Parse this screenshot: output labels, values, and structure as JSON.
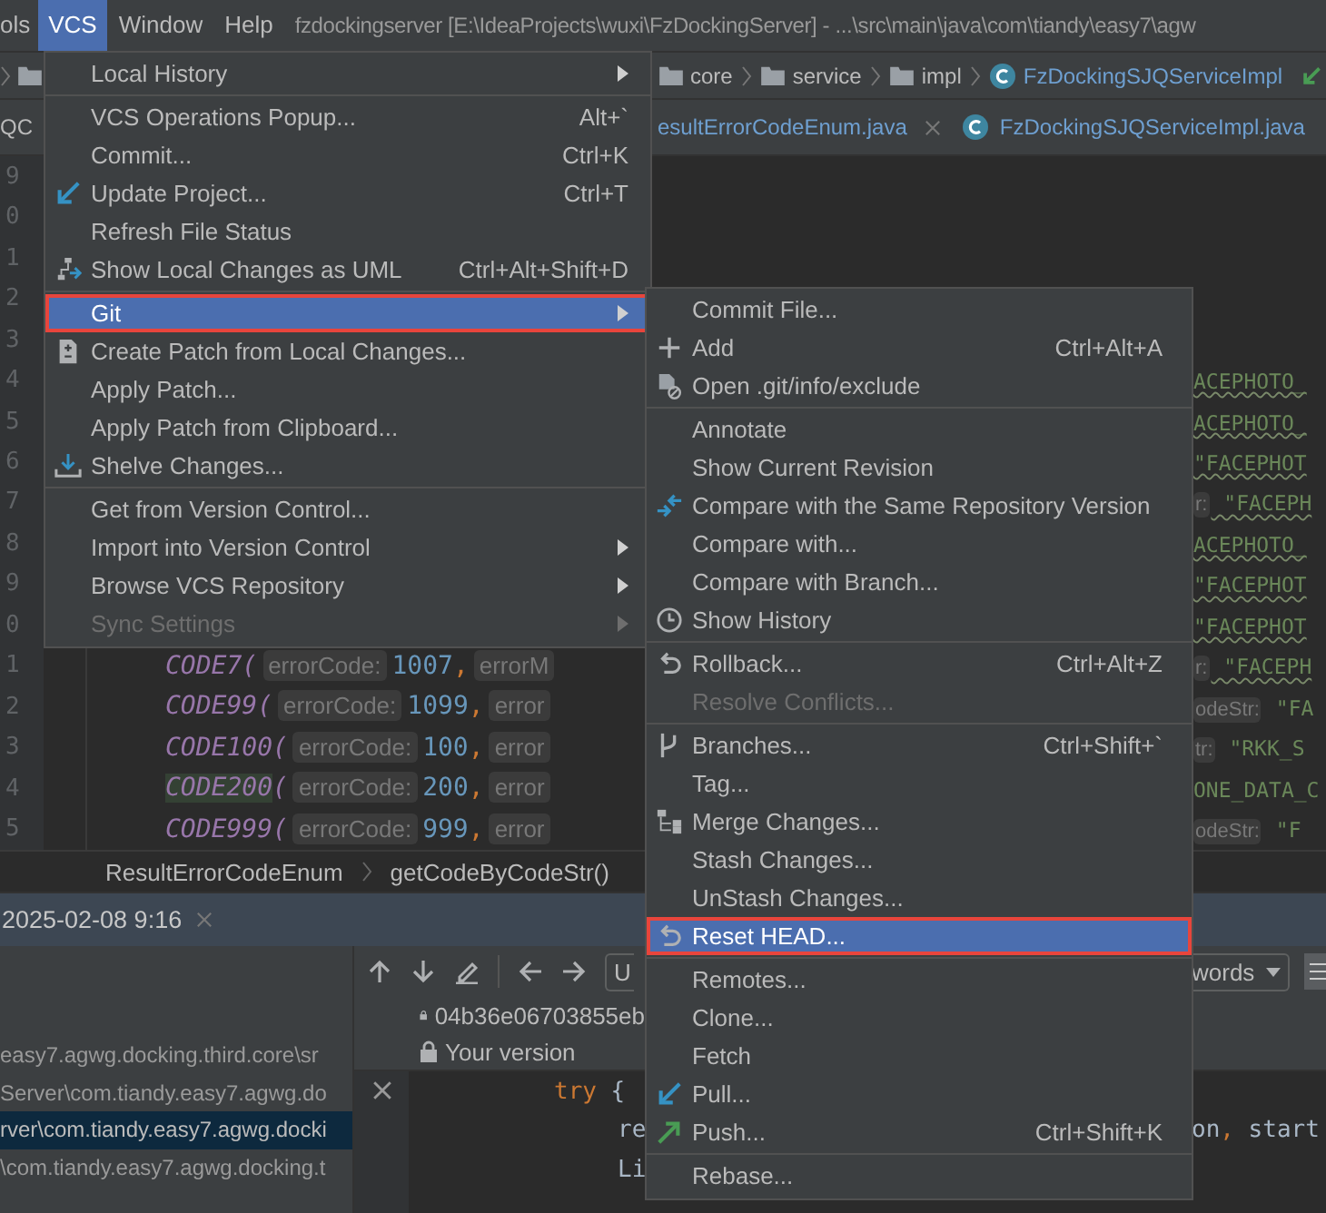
{
  "menu_bar": {
    "items": [
      {
        "label": "ols",
        "selected": false
      },
      {
        "label": "VCS",
        "selected": true
      },
      {
        "label": "Window",
        "selected": false
      },
      {
        "label": "Help",
        "selected": false
      }
    ],
    "title": "fzdockingserver [E:\\IdeaProjects\\wuxi\\FzDockingServer] - ...\\src\\main\\java\\com\\tiandy\\easy7\\agw"
  },
  "navigation_bar": {
    "crumbs": [
      {
        "label": "core",
        "kind": "folder"
      },
      {
        "label": "service",
        "kind": "folder"
      },
      {
        "label": "impl",
        "kind": "folder"
      },
      {
        "label": "FzDockingSJQServiceImpl",
        "kind": "class"
      }
    ]
  },
  "editor_tabs": [
    {
      "label": "QC",
      "kind": "plain",
      "modified": false
    },
    {
      "label": "esultErrorCodeEnum.java",
      "kind": "plain",
      "modified": true,
      "closable": true
    },
    {
      "label": "FzDockingSJQServiceImpl.java",
      "kind": "class",
      "modified": true,
      "closable": false
    }
  ],
  "editor": {
    "lines": [
      {
        "number": "9"
      },
      {
        "number": "0"
      },
      {
        "number": "1"
      },
      {
        "number": "2"
      },
      {
        "number": "3"
      },
      {
        "number": "4",
        "tail": [
          {
            "text": "ACEPHOTO_",
            "kind": "string_warning"
          }
        ]
      },
      {
        "number": "5",
        "tail": [
          {
            "text": "ACEPHOTO_",
            "kind": "string_warning"
          }
        ]
      },
      {
        "number": "6",
        "tail": [
          {
            "text": "\"FACEPHOT",
            "kind": "string_warning"
          }
        ]
      },
      {
        "number": "7",
        "tail": [
          {
            "text": "r:",
            "kind": "hint"
          },
          {
            "text": " \"FACEPH",
            "kind": "string_warning"
          }
        ]
      },
      {
        "number": "8",
        "tail": [
          {
            "text": "ACEPHOTO_",
            "kind": "string_warning"
          }
        ]
      },
      {
        "number": "9",
        "tail": [
          {
            "text": "\"FACEPHOT",
            "kind": "string_warning"
          }
        ]
      },
      {
        "number": "0",
        "tail": [
          {
            "text": "\"FACEPHOT",
            "kind": "string_warning"
          }
        ]
      },
      {
        "number": "1",
        "code": [
          {
            "text": "CODE7(",
            "kind": "constant"
          },
          {
            "text": "errorCode:",
            "kind": "hint"
          },
          {
            "text": "1007",
            "kind": "number"
          },
          {
            "text": ",",
            "kind": "comma"
          },
          {
            "text": "errorM",
            "kind": "hint"
          }
        ],
        "tail": [
          {
            "text": "r:",
            "kind": "hint"
          },
          {
            "text": " \"FACEPH",
            "kind": "string_warning"
          }
        ]
      },
      {
        "number": "2",
        "code": [
          {
            "text": "CODE99(",
            "kind": "constant"
          },
          {
            "text": "errorCode:",
            "kind": "hint"
          },
          {
            "text": "1099",
            "kind": "number"
          },
          {
            "text": ",",
            "kind": "comma"
          },
          {
            "text": "error",
            "kind": "hint"
          }
        ],
        "tail": [
          {
            "text": "odeStr:",
            "kind": "hint"
          },
          {
            "text": " \"FA",
            "kind": "string"
          }
        ]
      },
      {
        "number": "3",
        "code": [
          {
            "text": "CODE100(",
            "kind": "constant"
          },
          {
            "text": "errorCode:",
            "kind": "hint"
          },
          {
            "text": "100",
            "kind": "number"
          },
          {
            "text": ",",
            "kind": "comma"
          },
          {
            "text": "error",
            "kind": "hint"
          }
        ],
        "tail": [
          {
            "text": "tr:",
            "kind": "hint"
          },
          {
            "text": " \"RKK_S",
            "kind": "string"
          }
        ]
      },
      {
        "number": "4",
        "code": [
          {
            "text": "CODE200",
            "kind": "constant_usage"
          },
          {
            "text": "(",
            "kind": "constant"
          },
          {
            "text": "errorCode:",
            "kind": "hint"
          },
          {
            "text": "200",
            "kind": "number"
          },
          {
            "text": ",",
            "kind": "comma"
          },
          {
            "text": "error",
            "kind": "hint"
          }
        ],
        "tail": [
          {
            "text": "ONE_DATA_C",
            "kind": "string"
          }
        ]
      },
      {
        "number": "5",
        "code": [
          {
            "text": "CODE999(",
            "kind": "constant"
          },
          {
            "text": "errorCode:",
            "kind": "hint"
          },
          {
            "text": "999",
            "kind": "number"
          },
          {
            "text": ",",
            "kind": "comma"
          },
          {
            "text": "error",
            "kind": "hint"
          }
        ],
        "tail": [
          {
            "text": "odeStr:",
            "kind": "hint"
          },
          {
            "text": " \"F",
            "kind": "string"
          }
        ]
      }
    ],
    "breadcrumbs": [
      "ResultErrorCodeEnum",
      "getCodeByCodeStr()"
    ]
  },
  "tool_window": {
    "tab": {
      "label": "2025-02-08 9:16"
    },
    "paths": [
      {
        "text": "easy7.agwg.docking.third.core\\sr",
        "selected": false
      },
      {
        "text": "Server\\com.tiandy.easy7.agwg.do",
        "selected": false
      },
      {
        "text": "rver\\com.tiandy.easy7.agwg.docki",
        "selected": true
      },
      {
        "text": "\\com.tiandy.easy7.agwg.docking.t",
        "selected": false
      }
    ],
    "toolbar": {
      "dropdown": "U",
      "filter": "words"
    },
    "revisions": [
      {
        "label": "04b36e06703855eb"
      },
      {
        "label": "Your version"
      }
    ],
    "lines": [
      {
        "kind": "outer",
        "close": true,
        "code": [
          {
            "text": "try",
            "kind": "keyword"
          },
          {
            "text": " {",
            "kind": "plain"
          }
        ]
      },
      {
        "kind": "inner",
        "close": false,
        "code": [
          {
            "text": "re",
            "kind": "plain"
          }
        ],
        "tail": [
          {
            "text": "on",
            "kind": "plain"
          },
          {
            "text": ",",
            "kind": "comma"
          },
          {
            "text": " start",
            "kind": "plain"
          }
        ]
      },
      {
        "kind": "inner",
        "close": false,
        "code": [
          {
            "text": "Li",
            "kind": "plain"
          }
        ]
      }
    ]
  },
  "vcs_menu": {
    "sections": [
      {
        "items": [
          {
            "label": "Local History",
            "kind": "plain",
            "submenu": true,
            "selected": false,
            "disabled": false,
            "framed": false
          }
        ]
      },
      {
        "items": [
          {
            "label": "VCS Operations Popup...",
            "shortcut": "Alt+`",
            "kind": "plain",
            "submenu": false,
            "selected": false,
            "disabled": false,
            "framed": false
          },
          {
            "label": "Commit...",
            "shortcut": "Ctrl+K",
            "kind": "plain",
            "submenu": false,
            "selected": false,
            "disabled": false,
            "framed": false
          },
          {
            "label": "Update Project...",
            "shortcut": "Ctrl+T",
            "kind": "update",
            "submenu": false,
            "selected": false,
            "disabled": false,
            "framed": false
          },
          {
            "label": "Refresh File Status",
            "kind": "plain",
            "submenu": false,
            "selected": false,
            "disabled": false,
            "framed": false
          },
          {
            "label": "Show Local Changes as UML",
            "shortcut": "Ctrl+Alt+Shift+D",
            "kind": "uml",
            "submenu": false,
            "selected": false,
            "disabled": false,
            "framed": false
          }
        ]
      },
      {
        "items": [
          {
            "label": "Git",
            "kind": "plain",
            "submenu": true,
            "selected": true,
            "disabled": false,
            "framed": true
          },
          {
            "label": "Create Patch from Local Changes...",
            "kind": "patch",
            "submenu": false,
            "selected": false,
            "disabled": false,
            "framed": false
          },
          {
            "label": "Apply Patch...",
            "kind": "plain",
            "submenu": false,
            "selected": false,
            "disabled": false,
            "framed": false
          },
          {
            "label": "Apply Patch from Clipboard...",
            "kind": "plain",
            "submenu": false,
            "selected": false,
            "disabled": false,
            "framed": false
          },
          {
            "label": "Shelve Changes...",
            "kind": "shelve",
            "submenu": false,
            "selected": false,
            "disabled": false,
            "framed": false
          }
        ]
      },
      {
        "items": [
          {
            "label": "Get from Version Control...",
            "kind": "plain",
            "submenu": false,
            "selected": false,
            "disabled": false,
            "framed": false
          },
          {
            "label": "Import into Version Control",
            "kind": "plain",
            "submenu": true,
            "selected": false,
            "disabled": false,
            "framed": false
          },
          {
            "label": "Browse VCS Repository",
            "kind": "plain",
            "submenu": true,
            "selected": false,
            "disabled": false,
            "framed": false
          },
          {
            "label": "Sync Settings",
            "kind": "plain",
            "submenu": true,
            "selected": false,
            "disabled": true,
            "framed": false
          }
        ]
      }
    ]
  },
  "git_submenu": {
    "sections": [
      {
        "items": [
          {
            "label": "Commit File...",
            "kind": "plain",
            "submenu": false,
            "selected": false,
            "disabled": false,
            "framed": false
          },
          {
            "label": "Add",
            "shortcut": "Ctrl+Alt+A",
            "kind": "add",
            "submenu": false,
            "selected": false,
            "disabled": false,
            "framed": false
          },
          {
            "label": "Open .git/info/exclude",
            "kind": "exclude",
            "submenu": false,
            "selected": false,
            "disabled": false,
            "framed": false
          }
        ]
      },
      {
        "items": [
          {
            "label": "Annotate",
            "kind": "plain",
            "submenu": false,
            "selected": false,
            "disabled": false,
            "framed": false
          },
          {
            "label": "Show Current Revision",
            "kind": "plain",
            "submenu": false,
            "selected": false,
            "disabled": false,
            "framed": false
          },
          {
            "label": "Compare with the Same Repository Version",
            "kind": "compare",
            "submenu": false,
            "selected": false,
            "disabled": false,
            "framed": false
          },
          {
            "label": "Compare with...",
            "kind": "plain",
            "submenu": false,
            "selected": false,
            "disabled": false,
            "framed": false
          },
          {
            "label": "Compare with Branch...",
            "kind": "plain",
            "submenu": false,
            "selected": false,
            "disabled": false,
            "framed": false
          },
          {
            "label": "Show History",
            "kind": "history",
            "submenu": false,
            "selected": false,
            "disabled": false,
            "framed": false
          }
        ]
      },
      {
        "items": [
          {
            "label": "Rollback...",
            "shortcut": "Ctrl+Alt+Z",
            "kind": "rollback",
            "submenu": false,
            "selected": false,
            "disabled": false,
            "framed": false
          },
          {
            "label": "Resolve Conflicts...",
            "kind": "plain",
            "submenu": false,
            "selected": false,
            "disabled": true,
            "framed": false
          }
        ]
      },
      {
        "items": [
          {
            "label": "Branches...",
            "shortcut": "Ctrl+Shift+`",
            "kind": "branches",
            "submenu": false,
            "selected": false,
            "disabled": false,
            "framed": false
          },
          {
            "label": "Tag...",
            "kind": "plain",
            "submenu": false,
            "selected": false,
            "disabled": false,
            "framed": false
          },
          {
            "label": "Merge Changes...",
            "kind": "merge",
            "submenu": false,
            "selected": false,
            "disabled": false,
            "framed": false
          },
          {
            "label": "Stash Changes...",
            "kind": "plain",
            "submenu": false,
            "selected": false,
            "disabled": false,
            "framed": false
          },
          {
            "label": "UnStash Changes...",
            "kind": "plain",
            "submenu": false,
            "selected": false,
            "disabled": false,
            "framed": false
          },
          {
            "label": "Reset HEAD...",
            "kind": "reset",
            "submenu": false,
            "selected": true,
            "disabled": false,
            "framed": true
          }
        ]
      },
      {
        "items": [
          {
            "label": "Remotes...",
            "kind": "plain",
            "submenu": false,
            "selected": false,
            "disabled": false,
            "framed": false
          },
          {
            "label": "Clone...",
            "kind": "plain",
            "submenu": false,
            "selected": false,
            "disabled": false,
            "framed": false
          },
          {
            "label": "Fetch",
            "kind": "plain",
            "submenu": false,
            "selected": false,
            "disabled": false,
            "framed": false
          },
          {
            "label": "Pull...",
            "kind": "pull",
            "submenu": false,
            "selected": false,
            "disabled": false,
            "framed": false
          },
          {
            "label": "Push...",
            "shortcut": "Ctrl+Shift+K",
            "kind": "push",
            "submenu": false,
            "selected": false,
            "disabled": false,
            "framed": false
          }
        ]
      },
      {
        "items": [
          {
            "label": "Rebase...",
            "kind": "plain",
            "submenu": false,
            "selected": false,
            "disabled": false,
            "framed": false
          }
        ]
      }
    ]
  }
}
